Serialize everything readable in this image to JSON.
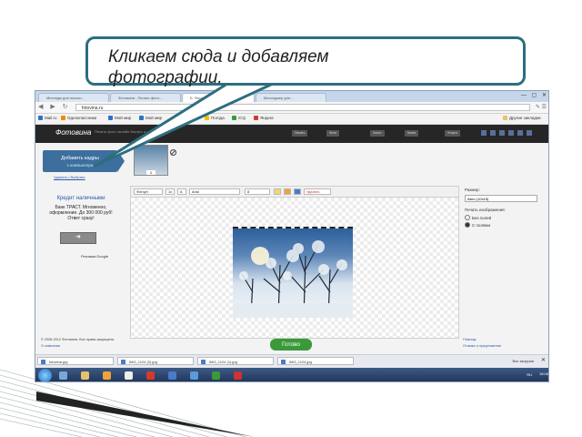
{
  "callout": {
    "line1": "Кликаем сюда и добавляем",
    "line2": "фотографии."
  },
  "browser": {
    "tabs": [
      "Месседж для пользо...",
      "Фотовина - Печать фото...",
      "Б. Фотовина - Печать...",
      "Месседжер для ..."
    ],
    "url": "fotovina.ru",
    "bookmarks": [
      "Mail.ru",
      "Одноклассники",
      "Мой мир",
      "Мой мир",
      "Игры",
      "Погода",
      "ICQ",
      "Яндекс",
      "Другие закладки"
    ],
    "colors": {
      "tabbar": "#c6d6ea"
    }
  },
  "site": {
    "logo": "Фотовина",
    "slogan": "Печать фото онлайн быстро и недорого",
    "header_nav": [
      "Печать",
      "Фото",
      "Холст",
      "Книга",
      "Услуги"
    ],
    "colors": {
      "header": "#262626",
      "accent": "#3d6f9e",
      "done": "#3a9a3a"
    }
  },
  "sidebar": {
    "add_button_line1": "Добавить кадры",
    "add_button_line2": "с компьютера",
    "add_links": "Удалить | Выбрать",
    "credit_title": "Кредит наличными",
    "credit_text": "Банк ТРАСТ. Мгновенно, оформление. До 300 000 руб! Ответ сразу!",
    "credit_button": "➜",
    "ads_by": "Реклама Google"
  },
  "editor": {
    "toolbar": [
      "Фотоуп",
      "1x",
      "A",
      "Arial",
      "8"
    ],
    "tool_remove": "Удалить"
  },
  "right_panel": {
    "size_label": "Размер:",
    "size_value": "Авто (10x15)",
    "mode_label": "Печать изображения:",
    "mode_options": [
      "Без полей",
      "С полями"
    ],
    "mode_selected": 1
  },
  "footer": {
    "left1": "© 2008-2012 Фотовина. Все права защищены",
    "left2": "О компании",
    "done_button": "Готово",
    "right1": "Помощь",
    "right2": "Отзывы и предложения"
  },
  "downloads": {
    "files": [
      "fotovina.jpg",
      "IMG_1124 (2).jpg",
      "IMG_1124 (1).jpg",
      "IMG_1124.jpg"
    ],
    "show_all": "Все загрузки"
  },
  "taskbar": {
    "tray": "RU",
    "clock": "18:08"
  }
}
